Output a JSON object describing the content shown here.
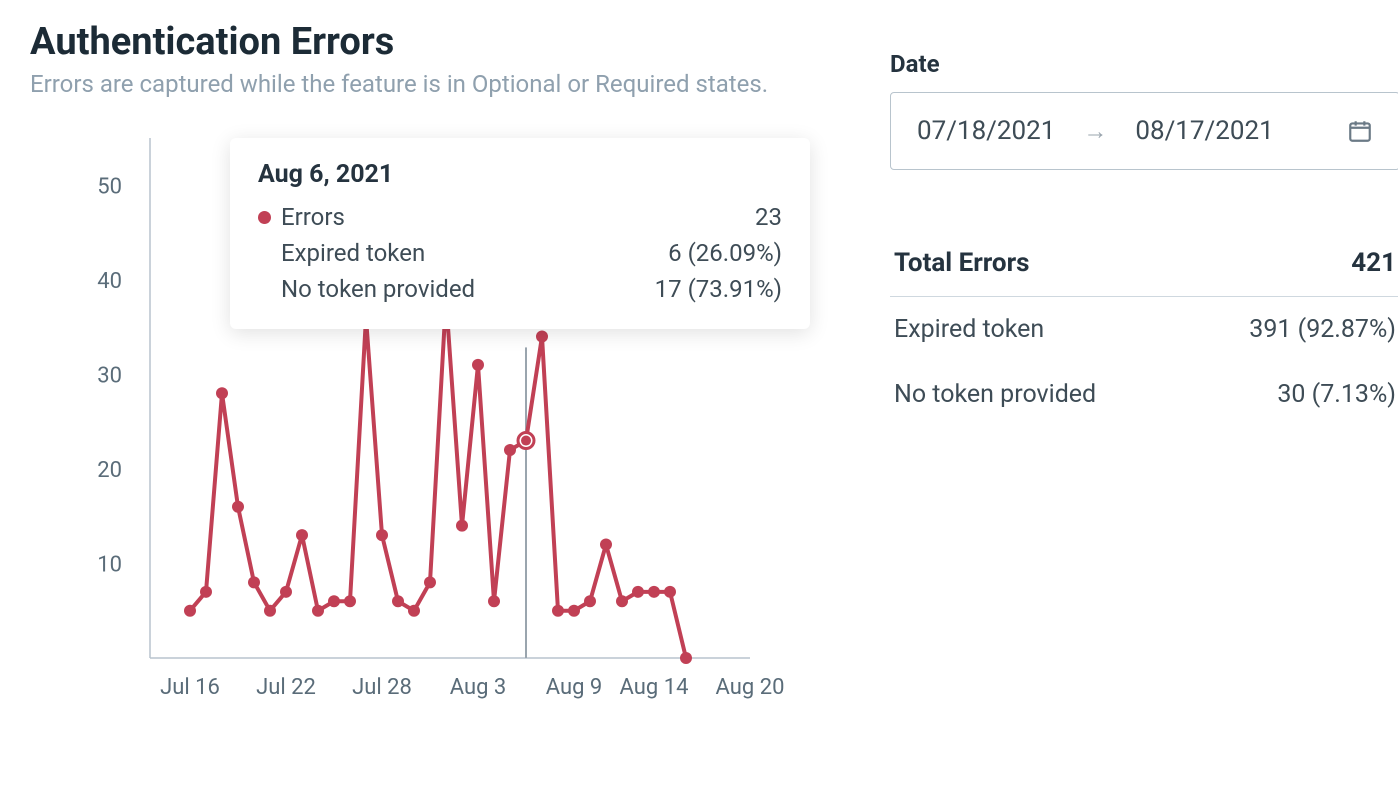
{
  "header": {
    "title": "Authentication Errors",
    "subtitle": "Errors are captured while the feature is in Optional or Required states."
  },
  "date_picker": {
    "label": "Date",
    "start": "07/18/2021",
    "end": "08/17/2021"
  },
  "summary": {
    "total_label": "Total Errors",
    "total_value": "421",
    "rows": [
      {
        "label": "Expired token",
        "value": "391 (92.87%)"
      },
      {
        "label": "No token provided",
        "value": "30 (7.13%)"
      }
    ]
  },
  "tooltip": {
    "date": "Aug 6, 2021",
    "series_label": "Errors",
    "series_value": "23",
    "rows": [
      {
        "label": "Expired token",
        "value": "6 (26.09%)"
      },
      {
        "label": "No token provided",
        "value": "17 (73.91%)"
      }
    ],
    "pos": {
      "left": 200,
      "top": 20
    }
  },
  "chart_data": {
    "type": "line",
    "title": "Authentication Errors",
    "xlabel": "",
    "ylabel": "",
    "ylim": [
      0,
      55
    ],
    "y_ticks": [
      10,
      20,
      30,
      40,
      50
    ],
    "x_tick_labels": [
      "Jul 16",
      "Jul 22",
      "Jul 28",
      "Aug 3",
      "Aug 9",
      "Aug 14",
      "Aug 20"
    ],
    "x_tick_indices": [
      0,
      6,
      12,
      18,
      24,
      29,
      35
    ],
    "series": [
      {
        "name": "Errors",
        "color": "#c14055",
        "values": [
          5,
          7,
          28,
          16,
          8,
          5,
          7,
          13,
          5,
          6,
          6,
          36,
          13,
          6,
          5,
          8,
          38,
          14,
          31,
          6,
          22,
          23,
          34,
          5,
          5,
          6,
          12,
          6,
          7,
          7,
          7,
          0
        ]
      }
    ],
    "hover_index": 21
  }
}
